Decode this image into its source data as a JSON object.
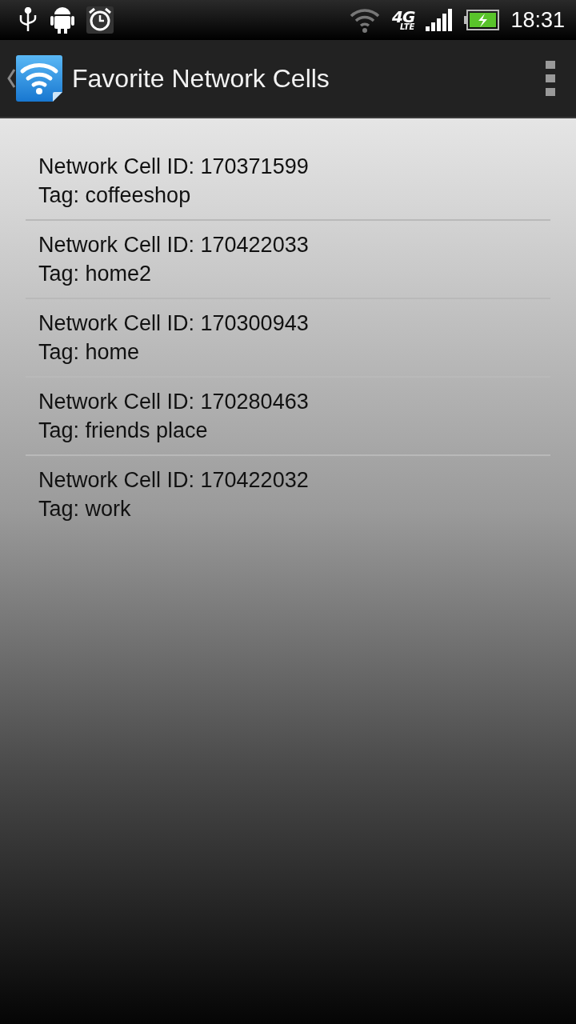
{
  "status_bar": {
    "network_label": "4G",
    "network_sublabel": "LTE",
    "time": "18:31"
  },
  "action_bar": {
    "title": "Favorite Network Cells"
  },
  "cells": [
    {
      "cell_id": "Network Cell ID: 170371599",
      "tag": "Tag: coffeeshop"
    },
    {
      "cell_id": "Network Cell ID: 170422033",
      "tag": "Tag: home2"
    },
    {
      "cell_id": "Network Cell ID: 170300943",
      "tag": "Tag: home"
    },
    {
      "cell_id": "Network Cell ID: 170280463",
      "tag": "Tag: friends place"
    },
    {
      "cell_id": "Network Cell ID: 170422032",
      "tag": "Tag: work"
    }
  ]
}
